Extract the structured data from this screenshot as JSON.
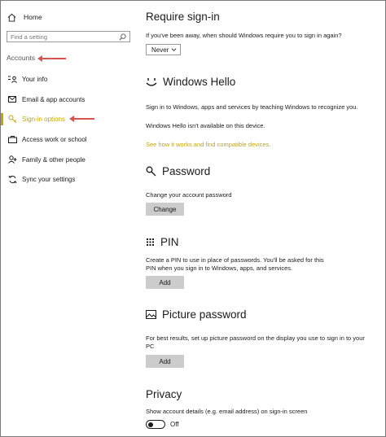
{
  "sidebar": {
    "home_label": "Home",
    "search_placeholder": "Find a setting",
    "section_label": "Accounts",
    "items": [
      {
        "label": "Your info",
        "icon": "your-info-icon"
      },
      {
        "label": "Email & app accounts",
        "icon": "email-icon"
      },
      {
        "label": "Sign-in options",
        "icon": "key-icon",
        "active": true
      },
      {
        "label": "Access work or school",
        "icon": "briefcase-icon"
      },
      {
        "label": "Family & other people",
        "icon": "person-add-icon"
      },
      {
        "label": "Sync your settings",
        "icon": "sync-icon"
      }
    ]
  },
  "main": {
    "require_signin": {
      "title": "Require sign-in",
      "question": "If you've been away, when should Windows require you to sign in again?",
      "selected": "Never"
    },
    "hello": {
      "title": "Windows Hello",
      "desc": "Sign in to Windows, apps and services by teaching Windows to recognize you.",
      "unavailable": "Windows Hello isn't available on this device.",
      "link": "See how it works and find compatible devices."
    },
    "password": {
      "title": "Password",
      "desc": "Change your account password",
      "button": "Change"
    },
    "pin": {
      "title": "PIN",
      "desc_line1": "Create a PIN to use in place of passwords. You'll be asked for this",
      "desc_line2": "PIN when you sign in to Windows, apps, and services.",
      "button": "Add"
    },
    "picture_password": {
      "title": "Picture password",
      "desc_line1": "For best results, set up picture password on the display you use to sign in to your",
      "desc_line2": "PC",
      "button": "Add"
    },
    "privacy": {
      "title": "Privacy",
      "desc": "Show account details (e.g. email address) on sign-in screen",
      "toggle_state": "Off"
    }
  },
  "colors": {
    "accent": "#c5a600",
    "annotation_arrow": "#d9534f",
    "button_bg": "#cccccc"
  }
}
